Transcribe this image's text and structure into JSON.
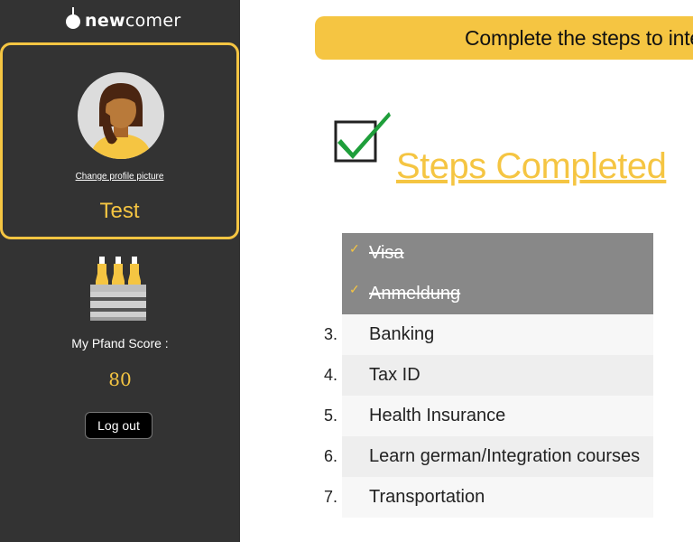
{
  "brand": {
    "logo_bold": "new",
    "logo_rest": "comer"
  },
  "profile": {
    "change_picture": "Change profile picture",
    "name": "Test"
  },
  "pfand": {
    "label": "My Pfand Score :",
    "value": "80"
  },
  "sidebar": {
    "logout": "Log out"
  },
  "banner": {
    "text": "Complete the steps to integ"
  },
  "steps": {
    "title": "Steps Completed",
    "items": [
      {
        "number": "",
        "label": "Visa",
        "completed": true
      },
      {
        "number": "",
        "label": "Anmeldung",
        "completed": true
      },
      {
        "number": "3.",
        "label": "Banking",
        "completed": false
      },
      {
        "number": "4.",
        "label": "Tax ID",
        "completed": false
      },
      {
        "number": "5.",
        "label": "Health Insurance",
        "completed": false
      },
      {
        "number": "6.",
        "label": "Learn german/Integration courses",
        "completed": false
      },
      {
        "number": "7.",
        "label": "Transportation",
        "completed": false
      }
    ]
  },
  "colors": {
    "accent": "#f5c542",
    "sidebar": "#333333",
    "done_row": "#888888",
    "check_green": "#1e9e3a"
  }
}
